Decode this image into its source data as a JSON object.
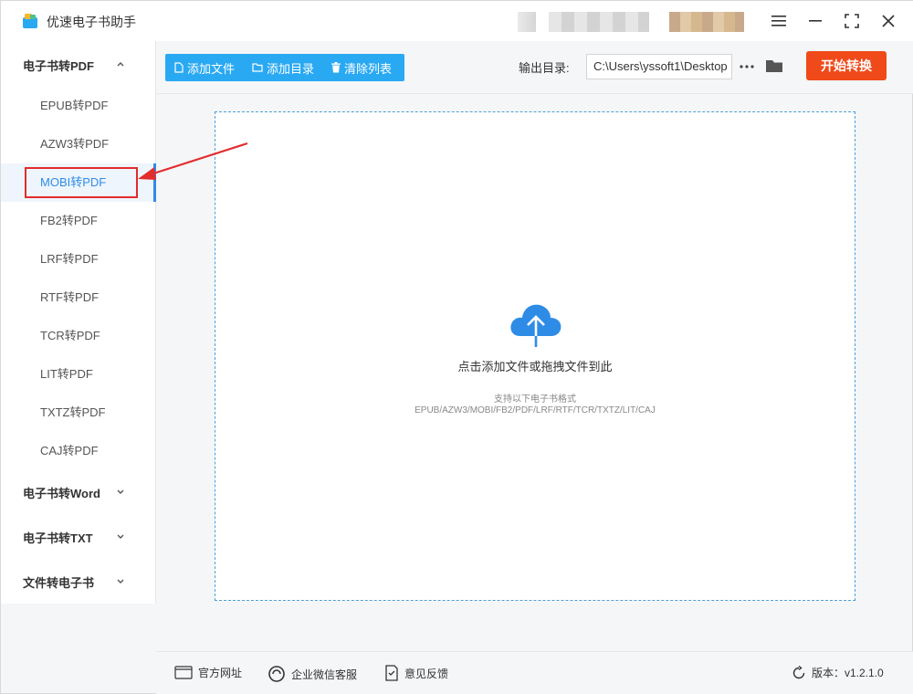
{
  "app": {
    "title": "优速电子书助手"
  },
  "sidebar": {
    "groups": [
      {
        "label": "电子书转PDF",
        "expanded": true,
        "items": [
          {
            "label": "EPUB转PDF"
          },
          {
            "label": "AZW3转PDF"
          },
          {
            "label": "MOBI转PDF",
            "active": true
          },
          {
            "label": "FB2转PDF"
          },
          {
            "label": "LRF转PDF"
          },
          {
            "label": "RTF转PDF"
          },
          {
            "label": "TCR转PDF"
          },
          {
            "label": "LIT转PDF"
          },
          {
            "label": "TXTZ转PDF"
          },
          {
            "label": "CAJ转PDF"
          }
        ]
      },
      {
        "label": "电子书转Word",
        "expanded": false
      },
      {
        "label": "电子书转TXT",
        "expanded": false
      },
      {
        "label": "文件转电子书",
        "expanded": false
      }
    ]
  },
  "toolbar": {
    "add_file": "添加文件",
    "add_dir": "添加目录",
    "clear_list": "清除列表",
    "output_label": "输出目录:",
    "output_value": "C:\\Users\\yssoft1\\Desktop",
    "start": "开始转换"
  },
  "dropzone": {
    "main": "点击添加文件或拖拽文件到此",
    "support_title": "支持以下电子书格式",
    "formats": "EPUB/AZW3/MOBI/FB2/PDF/LRF/RTF/TCR/TXTZ/LIT/CAJ"
  },
  "footer": {
    "website": "官方网址",
    "wechat": "企业微信客服",
    "feedback": "意见反馈",
    "version": "版本：v1.2.1.0"
  },
  "colors": {
    "accent": "#2aa9f3",
    "primary_action": "#f04a1a",
    "active_text": "#2e8ce6",
    "highlight_box": "#e32c2c"
  }
}
